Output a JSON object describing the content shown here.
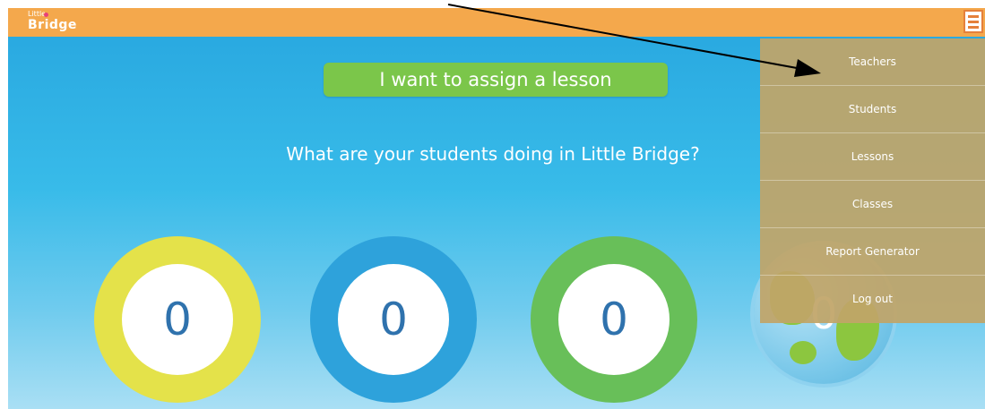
{
  "header": {
    "logo_small": "Little",
    "logo_big": "Bridge",
    "menu_icon": "hamburger-menu-icon",
    "bar_color": "#f4a84c"
  },
  "main": {
    "assign_button": "I want to assign a lesson",
    "question": "What are your students doing in Little Bridge?",
    "stats": [
      {
        "value": "0",
        "ring_color": "#e4e24a"
      },
      {
        "value": "0",
        "ring_color": "#2ea2db"
      },
      {
        "value": "0",
        "ring_color": "#68bf59"
      },
      {
        "value": "0",
        "icon": "globe-icon"
      }
    ]
  },
  "menu": {
    "items": [
      {
        "label": "Teachers"
      },
      {
        "label": "Students"
      },
      {
        "label": "Lessons"
      },
      {
        "label": "Classes"
      },
      {
        "label": "Report Generator"
      },
      {
        "label": "Log out"
      }
    ]
  },
  "annotation": {
    "icon": "arrow-icon",
    "color": "#000000"
  }
}
